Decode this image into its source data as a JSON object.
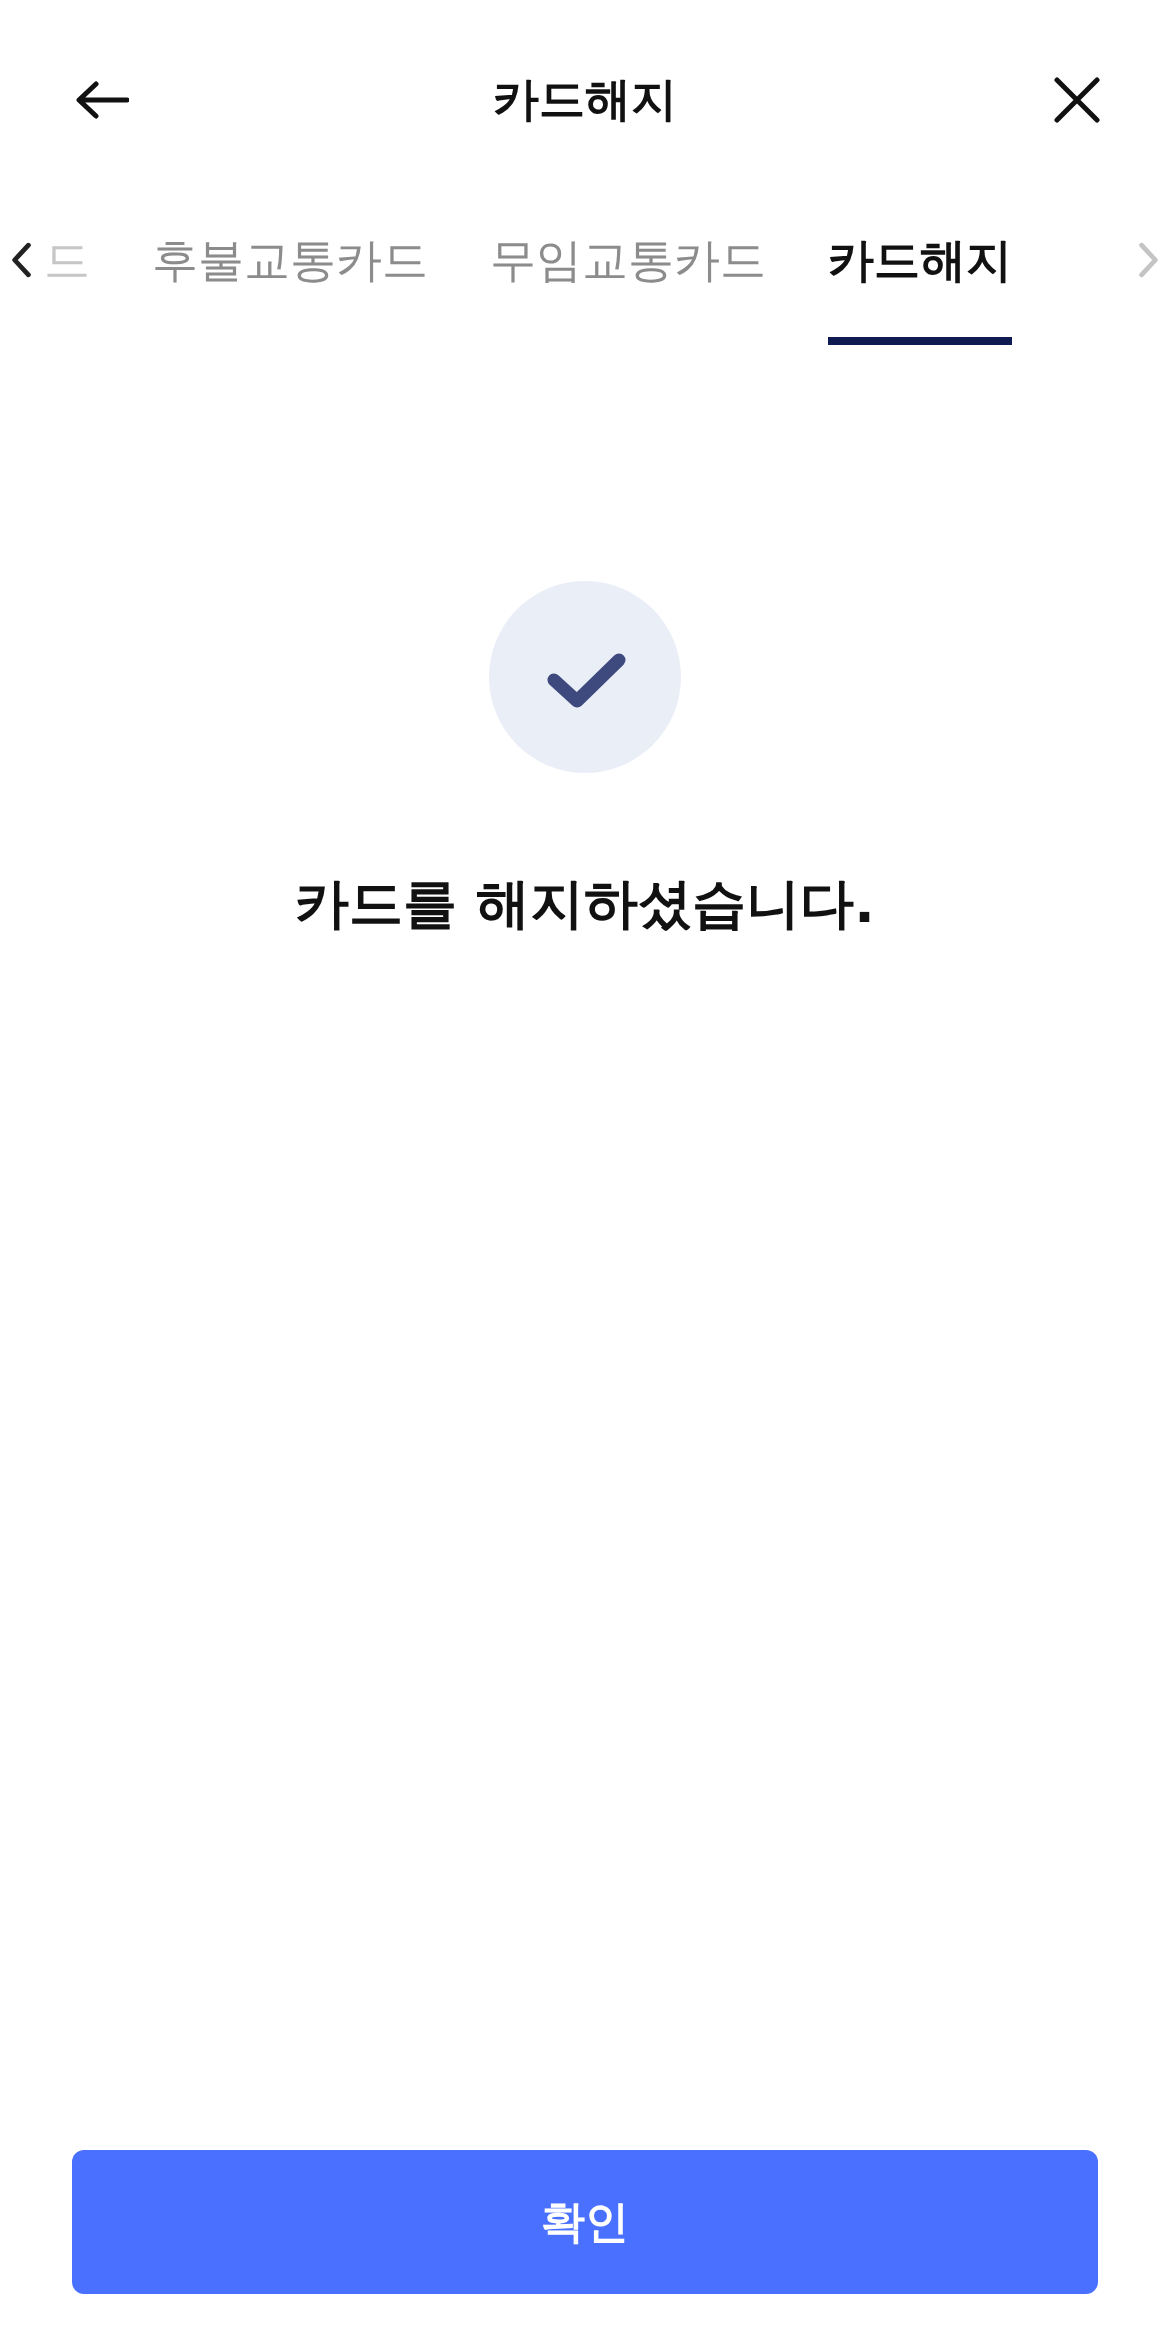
{
  "header": {
    "title": "카드해지"
  },
  "tab_arrows": [
    {
      "kind": "left",
      "disabled": false
    },
    {
      "kind": "right",
      "disabled": true
    }
  ],
  "tabs": [
    {
      "label": "드",
      "kind": "partial",
      "selected": false
    },
    {
      "label": "후불교통카드",
      "kind": "full",
      "selected": false
    },
    {
      "label": "무임교통카드",
      "kind": "full",
      "selected": false
    },
    {
      "label": "카드해지",
      "kind": "full",
      "selected": true
    }
  ],
  "result": {
    "message": "카드를 해지하셨습니다."
  },
  "confirm_button": {
    "label": "확인"
  }
}
